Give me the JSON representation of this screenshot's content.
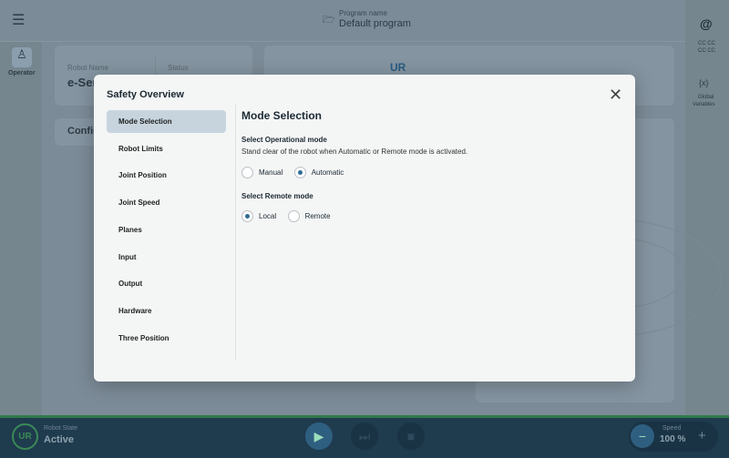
{
  "header": {
    "program_label": "Program name",
    "program_name": "Default program"
  },
  "left_rail": {
    "operator_label": "Operator"
  },
  "right_rail": {
    "cc_line1": "CC CC",
    "cc_line2": "CC CC",
    "vars_icon": "{x}",
    "global_vars_line1": "Global",
    "global_vars_line2": "Variables"
  },
  "background": {
    "robot_name_label": "Robot Name",
    "robot_name_value": "e-Seri",
    "status_label": "Status",
    "config_label": "Config",
    "logo_text": "UR"
  },
  "modal": {
    "title": "Safety Overview",
    "nav": [
      "Mode Selection",
      "Robot Limits",
      "Joint Position",
      "Joint Speed",
      "Planes",
      "Input",
      "Output",
      "Hardware",
      "Three Position"
    ],
    "active_index": 0,
    "section_title": "Mode Selection",
    "operational": {
      "label": "Select Operational mode",
      "hint": "Stand clear of the robot when Automatic or Remote mode is activated.",
      "options": [
        "Manual",
        "Automatic"
      ],
      "selected": "Automatic"
    },
    "remote": {
      "label": "Select Remote mode",
      "options": [
        "Local",
        "Remote"
      ],
      "selected": "Local"
    }
  },
  "footer": {
    "state_label": "Robot State",
    "state_value": "Active",
    "speed_label": "Speed",
    "speed_value": "100 %",
    "minus": "−",
    "plus": "+"
  },
  "colors": {
    "accent": "#2e6b95",
    "bar": "#1f3b4e",
    "green": "#2f7a4a"
  }
}
